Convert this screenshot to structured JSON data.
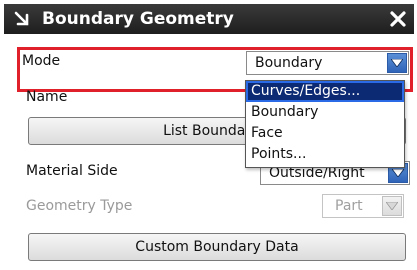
{
  "dialog": {
    "title": "Boundary Geometry",
    "title_icon": "collapse-arrow-icon",
    "close_icon": "close-icon"
  },
  "rows": {
    "mode": {
      "label": "Mode",
      "value": "Boundary"
    },
    "name": {
      "label": "Name"
    },
    "material_side": {
      "label": "Material Side",
      "value": "Outside/Right"
    },
    "geometry_type": {
      "label": "Geometry Type",
      "value": "Part",
      "disabled": true
    }
  },
  "buttons": {
    "list_boundaries": "List Boundaries",
    "custom_boundary_data": "Custom Boundary Data"
  },
  "dropdown": {
    "options": [
      "Curves/Edges...",
      "Boundary",
      "Face",
      "Points..."
    ],
    "highlighted_index": 0
  },
  "colors": {
    "highlight_border": "#e0202a",
    "selected_item_bg": "#0c2a73",
    "arrow_button": "#2f64b8"
  }
}
